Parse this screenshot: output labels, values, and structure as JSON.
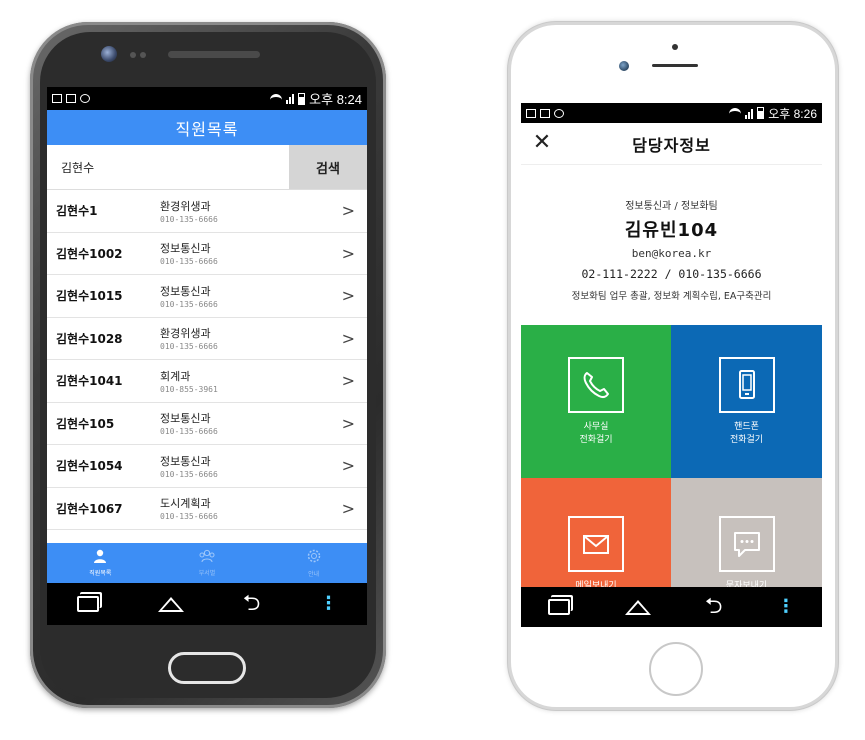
{
  "left_phone": {
    "status": {
      "time": "오후 8:24"
    },
    "title": "직원목록",
    "search": {
      "value": "김현수",
      "button": "검색"
    },
    "employees": [
      {
        "name": "김현수1",
        "dept": "환경위생과",
        "phone": "010-135-6666"
      },
      {
        "name": "김현수1002",
        "dept": "정보통신과",
        "phone": "010-135-6666"
      },
      {
        "name": "김현수1015",
        "dept": "정보통신과",
        "phone": "010-135-6666"
      },
      {
        "name": "김현수1028",
        "dept": "환경위생과",
        "phone": "010-135-6666"
      },
      {
        "name": "김현수1041",
        "dept": "회계과",
        "phone": "010-855-3961"
      },
      {
        "name": "김현수105",
        "dept": "정보통신과",
        "phone": "010-135-6666"
      },
      {
        "name": "김현수1054",
        "dept": "정보통신과",
        "phone": "010-135-6666"
      },
      {
        "name": "김현수1067",
        "dept": "도시계획과",
        "phone": "010-135-6666"
      }
    ],
    "tabs": [
      {
        "label": "직원목록",
        "icon": "person-icon"
      },
      {
        "label": "부서별",
        "icon": "group-icon"
      },
      {
        "label": "안내",
        "icon": "gear-icon"
      }
    ]
  },
  "right_phone": {
    "status": {
      "time": "오후 8:26"
    },
    "title": "담당자정보",
    "profile": {
      "dept": "정보통신과 / 정보화팀",
      "name": "김유빈104",
      "email": "ben@korea.kr",
      "phones": "02-111-2222 / 010-135-6666",
      "duty": "정보화팀 업무 총괄, 정보화 계획수립, EA구축관리"
    },
    "actions": [
      {
        "line1": "사무실",
        "line2": "전화걸기",
        "color": "#2aaf47",
        "icon": "phone-icon"
      },
      {
        "line1": "핸드폰",
        "line2": "전화걸기",
        "color": "#0c69b5",
        "icon": "mobile-icon"
      },
      {
        "line1": "메일보내기",
        "line2": "",
        "color": "#f0643a",
        "icon": "mail-icon"
      },
      {
        "line1": "문자보내기",
        "line2": "",
        "color": "#c7c1bd",
        "icon": "message-icon"
      }
    ]
  }
}
